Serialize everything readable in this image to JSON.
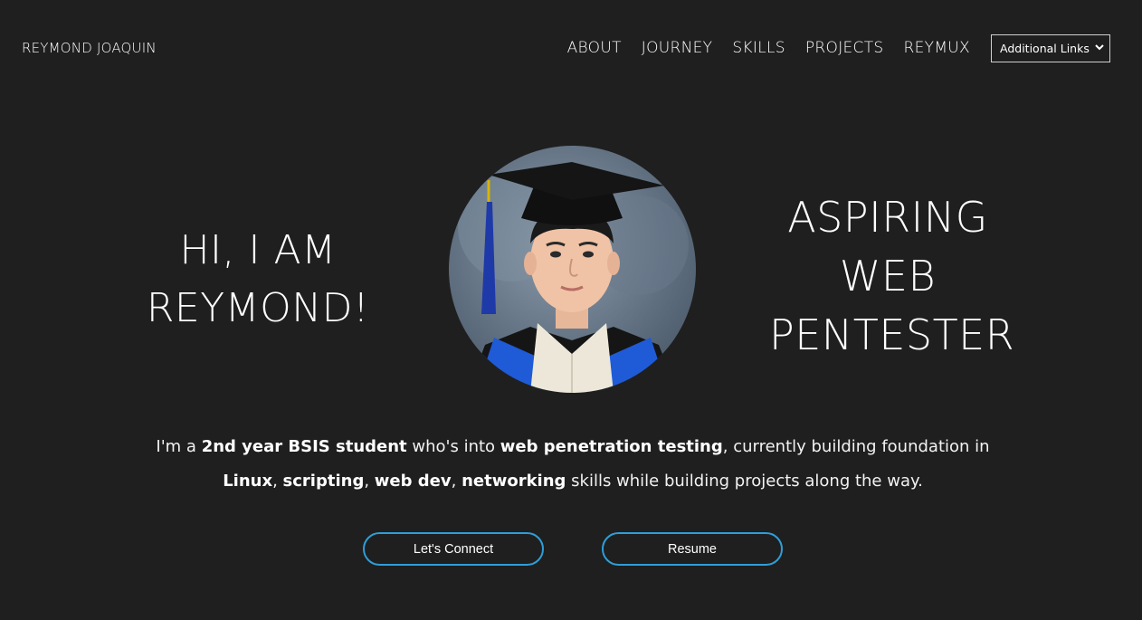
{
  "header": {
    "brand": "REYMOND JOAQUIN",
    "nav": [
      "ABOUT",
      "JOURNEY",
      "SKILLS",
      "PROJECTS",
      "REYMUX"
    ],
    "additional_links": {
      "selected": "Additional Links"
    }
  },
  "hero": {
    "greeting_line1": "HI, I AM",
    "greeting_line2": "REYMOND!",
    "role_line1": "ASPIRING",
    "role_line2": "WEB",
    "role_line3": "PENTESTER",
    "avatar_label": "graduation portrait photo"
  },
  "intro": {
    "p1": "I'm a ",
    "b1": "2nd year BSIS student",
    "p2": " who's into ",
    "b2": "web penetration testing",
    "p3": ", currently building foundation in",
    "b3": "Linux",
    "p4": ", ",
    "b4": "scripting",
    "p5": ", ",
    "b5": "web dev",
    "p6": ", ",
    "b6": "networking",
    "p7": " skills while building projects along the way."
  },
  "buttons": {
    "connect": "Let's Connect",
    "resume": "Resume"
  },
  "colors": {
    "background": "#1f1f1f",
    "accent": "#2f9ed8",
    "text": "#ffffff"
  }
}
